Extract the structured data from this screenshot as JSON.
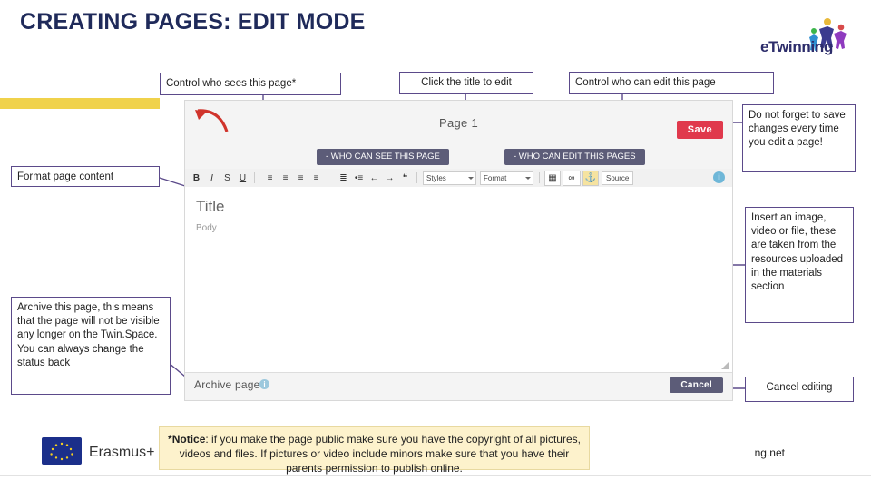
{
  "slide": {
    "title": "CREATING PAGES: EDIT MODE",
    "logo_text": "eTwinning",
    "site_url": "ng.net"
  },
  "callouts": {
    "who_sees": "Control who sees this page*",
    "click_title": "Click the title to edit",
    "who_edits": "Control who can edit this page",
    "save_note": "Do not forget to save changes every time you edit a page!",
    "format_content": "Format page content",
    "insert_media": "Insert an image, video or file, these are taken from the resources uploaded in the materials section",
    "archive_note": "Archive this page, this means that the page will not be visible any longer on the Twin.Space. You can always change the status back",
    "cancel_editing": "Cancel editing"
  },
  "screenshot": {
    "page_label": "Page 1",
    "save_label": "Save",
    "pill_see": "- WHO CAN SEE THIS PAGE",
    "pill_edit": "- WHO CAN EDIT THIS PAGES",
    "editor_title": "Title",
    "editor_body": "Body",
    "archive_label": "Archive page",
    "archive_info_icon": "i",
    "toolbar_info_icon": "i",
    "cancel_label": "Cancel",
    "toolbar": {
      "bold": "B",
      "italic": "I",
      "underline": "S",
      "strike": "U",
      "align_left": "≡",
      "align_center": "≡",
      "align_right": "≡",
      "align_justify": "≡",
      "ordered_list": "≣",
      "unordered_list": "•≡",
      "outdent": "←",
      "indent": "→",
      "quote": "❝",
      "styles_select": "Styles",
      "format_select": "Format",
      "table_icon": "▦",
      "link_icon": "∞",
      "anchor_icon": "⚓",
      "source_label": "Source"
    }
  },
  "notice": {
    "bold_lead": "*Notice",
    "text": ": if you make the page public make sure you have the copyright of all pictures, videos and files. If pictures or video include minors make sure that you have their parents permission to publish online."
  },
  "erasmus": {
    "label": "Erasmus+"
  },
  "colors": {
    "title": "#1f2a5a",
    "accent_yellow": "#f0d24b",
    "callout_border": "#5b4a8a",
    "save_red": "#e0394c",
    "pill_purple": "#5c5c78",
    "notice_bg": "#fdf2cc"
  }
}
